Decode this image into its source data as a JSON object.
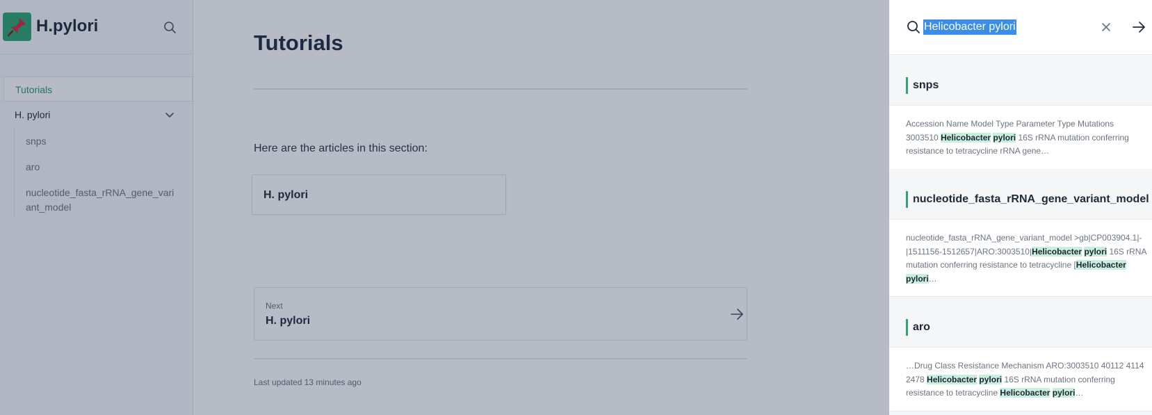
{
  "site": {
    "title": "H.pylori"
  },
  "sidebar": {
    "items": [
      {
        "label": "Tutorials"
      },
      {
        "label": "H. pylori"
      }
    ],
    "subitems": [
      {
        "label": "snps"
      },
      {
        "label": "aro"
      },
      {
        "label": "nucleotide_fasta_rRNA_gene_variant_model"
      }
    ]
  },
  "main": {
    "title": "Tutorials",
    "intro": "Here are the articles in this section:",
    "card_title": "H. pylori",
    "next_label": "Next",
    "next_title": "H. pylori",
    "updated": "Last updated 13 minutes ago"
  },
  "search": {
    "query": "Helicobacter pylori",
    "results": [
      {
        "title": "snps",
        "excerpt": [
          "Accession Name Model Type Parameter Type Mutations 3003510 ",
          "Helicobacter",
          " ",
          "pylori",
          " 16S rRNA mutation conferring resistance to tetracycline rRNA gene…"
        ]
      },
      {
        "title": "nucleotide_fasta_rRNA_gene_variant_model",
        "excerpt": [
          "nucleotide_fasta_rRNA_gene_variant_model >gb|CP003904.1|-|1511156-1512657|ARO:3003510|",
          "Helicobacter",
          " ",
          "pylori",
          " 16S rRNA mutation conferring resistance to tetracycline [",
          "Helicobacter",
          " ",
          "pylori",
          "…"
        ]
      },
      {
        "title": "aro",
        "excerpt": [
          "…Drug Class Resistance Mechanism ARO:3003510 40112 4114 2478 ",
          "Helicobacter",
          " ",
          "pylori",
          " 16S rRNA mutation conferring resistance to tetracycline ",
          "Helicobacter",
          " ",
          "pylori",
          "…"
        ]
      }
    ]
  },
  "colors": {
    "accent": "#2fa56f",
    "highlight": "#c9eedd",
    "selection": "#3a8ee6"
  }
}
